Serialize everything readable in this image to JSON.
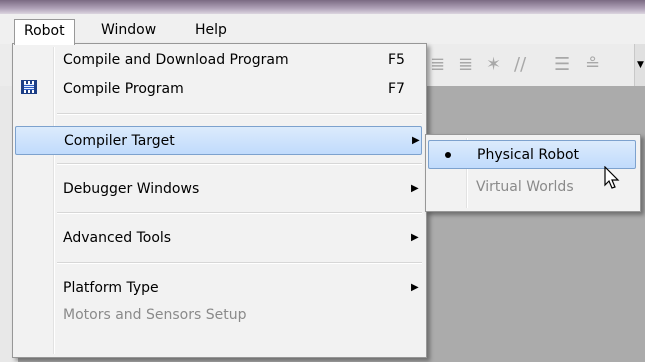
{
  "menubar": {
    "items": [
      {
        "label": "Robot",
        "active": true
      },
      {
        "label": "Window"
      },
      {
        "label": "Help"
      }
    ]
  },
  "robot_menu": {
    "items": [
      {
        "label": "Compile and Download Program",
        "shortcut": "F5"
      },
      {
        "label": "Compile Program",
        "shortcut": "F7",
        "icon": "compile-icon"
      },
      {
        "label": "Compiler Target",
        "submenu": true,
        "highlighted": true
      },
      {
        "label": "Debugger Windows",
        "submenu": true
      },
      {
        "label": "Advanced Tools",
        "submenu": true
      },
      {
        "label": "Platform Type",
        "submenu": true
      },
      {
        "label": "Motors and Sensors Setup",
        "disabled": true
      }
    ]
  },
  "compiler_target_submenu": {
    "items": [
      {
        "label": "Physical Robot",
        "selected": true,
        "highlighted": true
      },
      {
        "label": "Virtual Worlds",
        "disabled": true
      }
    ]
  },
  "colors": {
    "highlight_border": "#7da2ce",
    "highlight_fill": "#c1dbfc",
    "workspace": "#ababab"
  }
}
